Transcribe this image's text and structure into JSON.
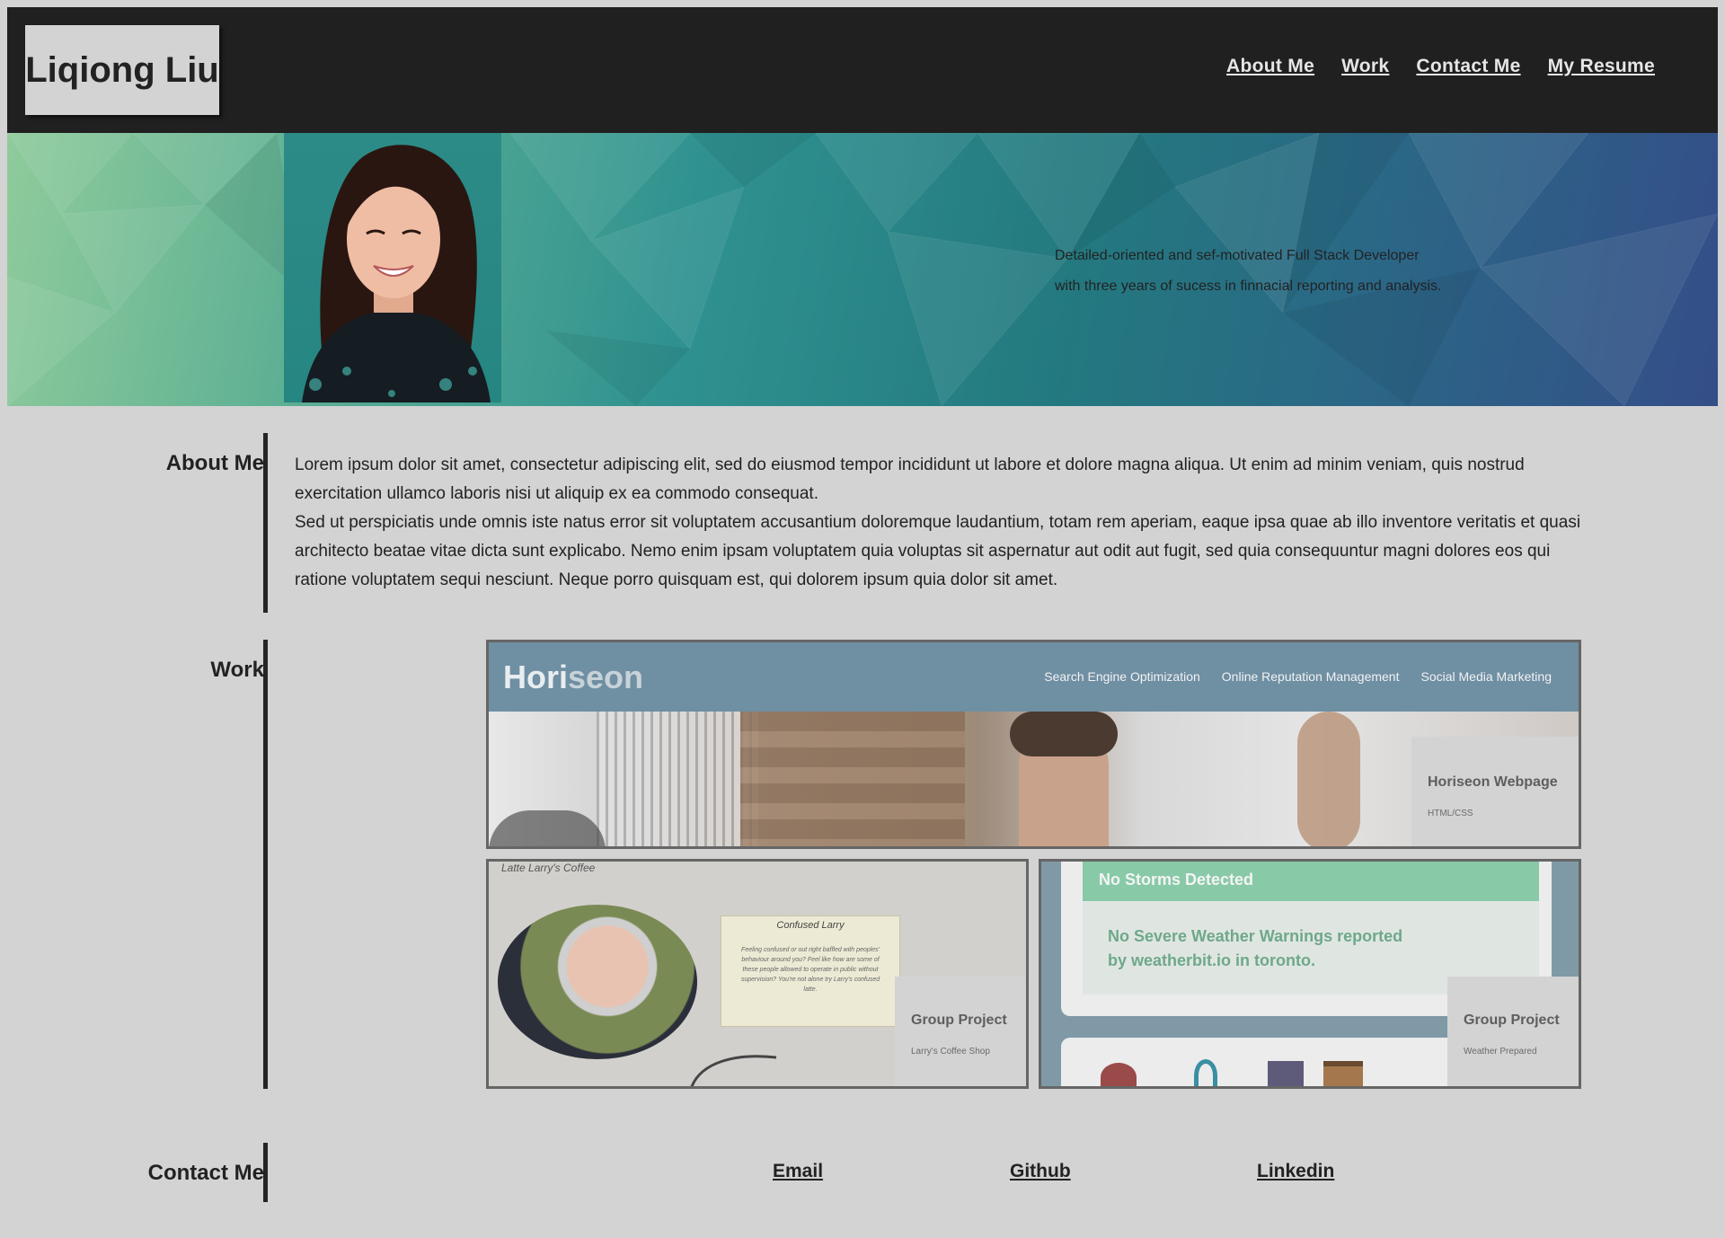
{
  "header": {
    "brand": "Liqiong Liu",
    "nav": [
      "About Me",
      "Work",
      "Contact Me",
      "My Resume"
    ]
  },
  "hero": {
    "tagline_line1": "Detailed-oriented and sef-motivated Full Stack Developer",
    "tagline_line2": "with three years of sucess in finnacial reporting and analysis."
  },
  "about": {
    "label": "About Me",
    "paragraph1": "Lorem ipsum dolor sit amet, consectetur adipiscing elit, sed do eiusmod tempor incididunt ut labore et dolore magna aliqua. Ut enim ad minim veniam, quis nostrud exercitation ullamco laboris nisi ut aliquip ex ea commodo consequat.",
    "paragraph2": "Sed ut perspiciatis unde omnis iste natus error sit voluptatem accusantium doloremque laudantium, totam rem aperiam, eaque ipsa quae ab illo inventore veritatis et quasi architecto beatae vitae dicta sunt explicabo. Nemo enim ipsam voluptatem quia voluptas sit aspernatur aut odit aut fugit, sed quia consequuntur magni dolores eos qui ratione voluptatem sequi nesciunt. Neque porro quisquam est, qui dolorem ipsum quia dolor sit amet."
  },
  "work": {
    "label": "Work",
    "horiseon": {
      "logo_a": "Hori",
      "logo_b": "seon",
      "nav": [
        "Search Engine Optimization",
        "Online Reputation Management",
        "Social Media Marketing"
      ],
      "title": "Horiseon Webpage",
      "subtitle": "HTML/CSS"
    },
    "coffee": {
      "site_title": "Latte Larry's Coffee",
      "note_title": "Confused Larry",
      "note_body": "Feeling confused or out right baffled with peoples' behaviour around you? Feel like how are some of these people allowed to operate in public without supervision? You're not alone try Larry's confused latte.",
      "title": "Group Project",
      "subtitle": "Larry's Coffee Shop"
    },
    "weather": {
      "banner": "No Storms Detected",
      "message": "No Severe Weather Warnings reported by weatherbit.io in toronto.",
      "title": "Group Project",
      "subtitle": "Weather Prepared"
    }
  },
  "contact": {
    "label": "Contact Me",
    "links": [
      "Email",
      "Github",
      "Linkedin"
    ]
  },
  "colors": {
    "header_bg": "#202020",
    "page_bg": "#d3d3d3",
    "horiseon_header": "#6f8fa3",
    "weather_banner": "#88c9a8"
  }
}
